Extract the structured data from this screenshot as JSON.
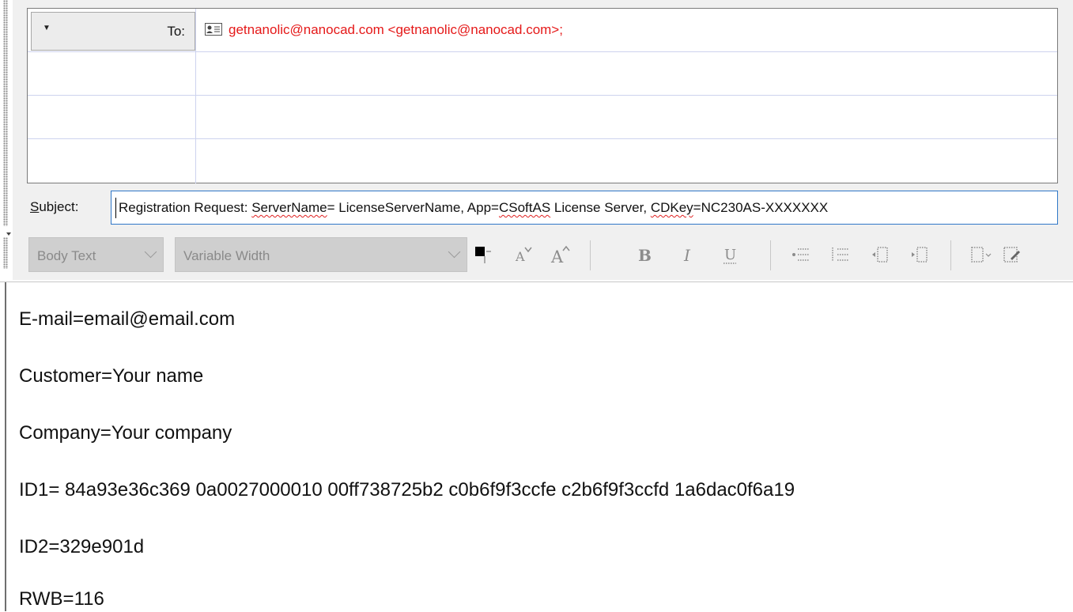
{
  "recipients": {
    "to_label": "To:",
    "to_value": "getnanolic@nanocad.com <getnanolic@nanocad.com>;"
  },
  "subject": {
    "label_prefix": "S",
    "label_rest": "ubject:",
    "segments": [
      {
        "text": "Registration Request: ",
        "spell": false
      },
      {
        "text": "ServerName",
        "spell": true
      },
      {
        "text": "= LicenseServerName, App=",
        "spell": false
      },
      {
        "text": "CSoftAS",
        "spell": true
      },
      {
        "text": " License Server, ",
        "spell": false
      },
      {
        "text": "CDKey",
        "spell": true
      },
      {
        "text": "=NC230AS-XXXXXXX",
        "spell": false
      }
    ]
  },
  "toolbar": {
    "style": "Body Text",
    "font": "Variable Width"
  },
  "body": {
    "lines": [
      "E-mail=email@email.com",
      "Customer=Your name",
      "Company=Your company",
      "ID1= 84a93e36c369 0a0027000010 00ff738725b2 c0b6f9f3ccfe c2b6f9f3ccfd 1a6dac0f6a19",
      "ID2=329e901d",
      "RWB=116"
    ]
  },
  "colors": {
    "recipient": "#e51919",
    "spelling_underline": "#e02020",
    "focus_border": "#2f77c7"
  },
  "icons": [
    "contact-card-icon",
    "font-color-icon",
    "shrink-font-icon",
    "grow-font-icon",
    "bold-icon",
    "italic-icon",
    "underline-icon",
    "bullets-icon",
    "numbering-icon",
    "decrease-indent-icon",
    "increase-indent-icon",
    "align-icon",
    "insert-icon"
  ]
}
